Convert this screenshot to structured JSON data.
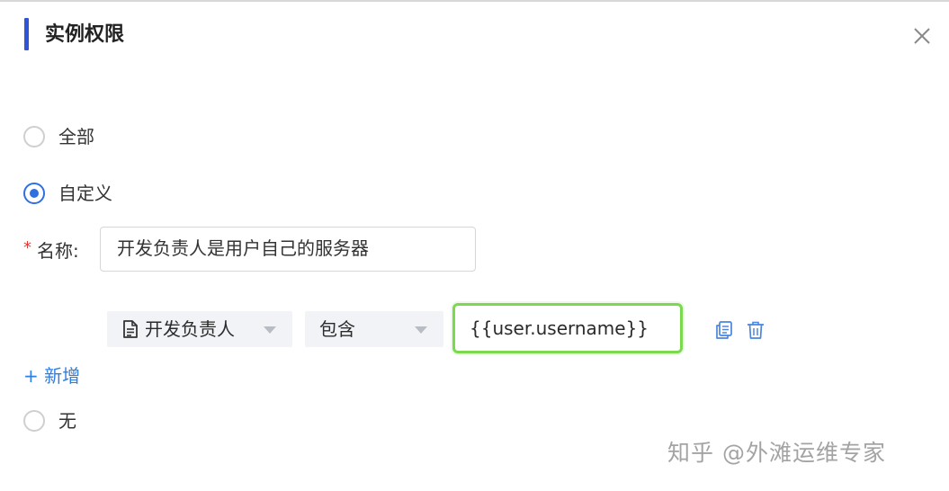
{
  "dialog": {
    "title": "实例权限",
    "accent_color": "#2f54d6"
  },
  "options": [
    {
      "label": "全部",
      "checked": false
    },
    {
      "label": "自定义",
      "checked": true
    },
    {
      "label": "无",
      "checked": false
    }
  ],
  "name_field": {
    "required_mark": "*",
    "label": "名称:",
    "value": "开发负责人是用户自己的服务器"
  },
  "rule": {
    "field": "开发负责人",
    "operator": "包含",
    "value": "{{user.username}}",
    "value_border_color": "#7ad94f"
  },
  "add_label": "+ 新增",
  "watermark": "知乎 @外滩运维专家",
  "colors": {
    "primary": "#2f6fe0",
    "link": "#2f7de0",
    "required": "#e5352e"
  }
}
